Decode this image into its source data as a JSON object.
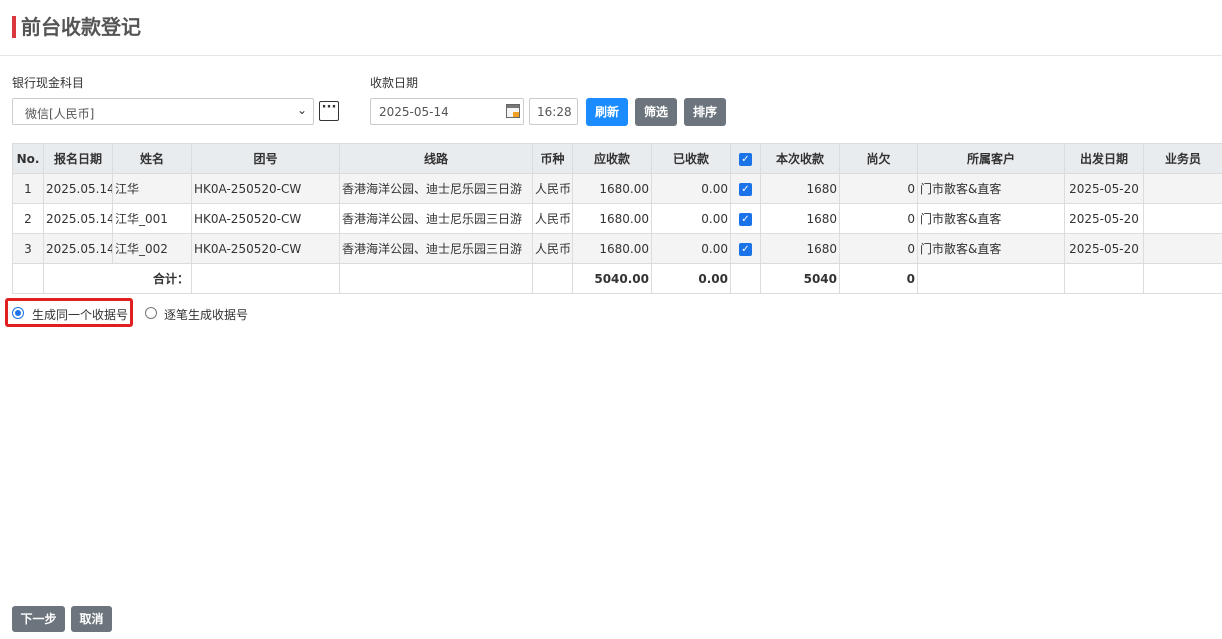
{
  "page": {
    "title": "前台收款登记"
  },
  "form": {
    "account_label": "银行现金科目",
    "account_value": "微信[人民币]",
    "date_label": "收款日期",
    "date_value": "2025-05-14",
    "time_value": "16:28",
    "more_glyph": "···",
    "dropdown_glyph": "⌄"
  },
  "toolbar": {
    "refresh": "刷新",
    "filter": "筛选",
    "sort": "排序"
  },
  "table": {
    "headers": {
      "no": "No.",
      "reg_date": "报名日期",
      "name": "姓名",
      "group_no": "团号",
      "route": "线路",
      "currency": "币种",
      "receivable": "应收款",
      "received": "已收款",
      "current": "本次收款",
      "owed": "尚欠",
      "customer": "所属客户",
      "depart_date": "出发日期",
      "salesperson": "业务员"
    },
    "rows": [
      {
        "no": "1",
        "reg_date": "2025.05.14",
        "name": "江华",
        "group_no": "HK0A-250520-CW",
        "route": "香港海洋公园、迪士尼乐园三日游",
        "currency": "人民币",
        "receivable": "1680.00",
        "received": "0.00",
        "checked": true,
        "current": "1680",
        "owed": "0",
        "customer": "门市散客&直客",
        "depart_date": "2025-05-20",
        "salesperson": ""
      },
      {
        "no": "2",
        "reg_date": "2025.05.14",
        "name": "江华_001",
        "group_no": "HK0A-250520-CW",
        "route": "香港海洋公园、迪士尼乐园三日游",
        "currency": "人民币",
        "receivable": "1680.00",
        "received": "0.00",
        "checked": true,
        "current": "1680",
        "owed": "0",
        "customer": "门市散客&直客",
        "depart_date": "2025-05-20",
        "salesperson": ""
      },
      {
        "no": "3",
        "reg_date": "2025.05.14",
        "name": "江华_002",
        "group_no": "HK0A-250520-CW",
        "route": "香港海洋公园、迪士尼乐园三日游",
        "currency": "人民币",
        "receivable": "1680.00",
        "received": "0.00",
        "checked": true,
        "current": "1680",
        "owed": "0",
        "customer": "门市散客&直客",
        "depart_date": "2025-05-20",
        "salesperson": ""
      }
    ],
    "totals": {
      "label": "合计：",
      "receivable": "5040.00",
      "received": "0.00",
      "current": "5040",
      "owed": "0"
    },
    "check_glyph": "✓"
  },
  "options": {
    "same_receipt": "生成同一个收据号",
    "each_receipt": "逐笔生成收据号",
    "selected": "same_receipt"
  },
  "footer": {
    "next": "下一步",
    "cancel": "取消"
  }
}
